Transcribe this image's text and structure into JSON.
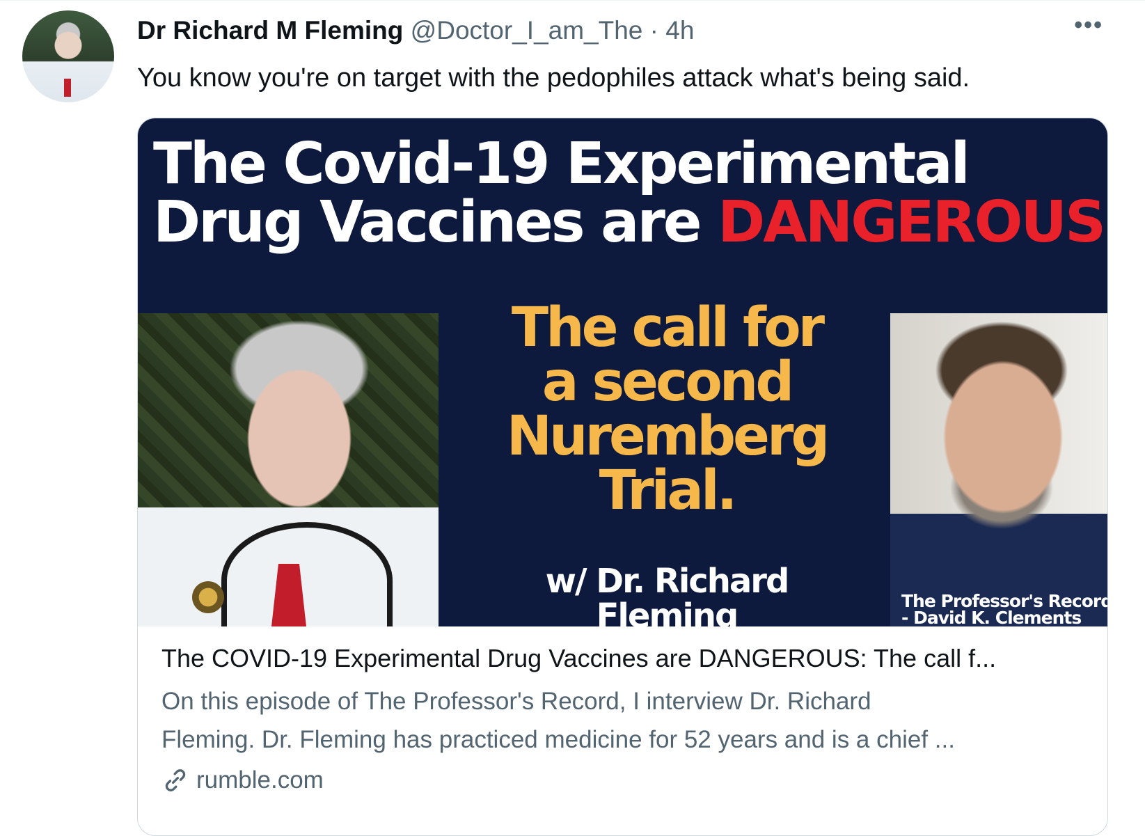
{
  "tweet": {
    "author_name": "Dr Richard M Fleming",
    "handle": "@Doctor_I_am_The",
    "separator": "·",
    "time": "4h",
    "more_label": "•••",
    "text": "You know you're on target with the pedophiles attack what's being said."
  },
  "card": {
    "image": {
      "headline_line1": "The Covid-19 Experimental",
      "headline_line2_start": "Drug Vaccines are",
      "headline_line2_highlight": "DANGEROUS.",
      "call_lines": [
        "The call for",
        "a second",
        "Nuremberg",
        "Trial."
      ],
      "with_line1": "w/ Dr. Richard",
      "with_line2": "Fleming",
      "credit_line1": "The Professor's Record",
      "credit_line2": "- David K. Clements"
    },
    "title": "The COVID-19 Experimental Drug Vaccines are DANGEROUS: The call f...",
    "description_line1": "On this episode of The Professor's Record, I interview Dr. Richard",
    "description_line2": "Fleming. Dr. Fleming has practiced medicine for 52 years and is a chief ...",
    "domain": "rumble.com",
    "link_icon": "link-icon"
  },
  "colors": {
    "media_bg": "#0e1a3d",
    "danger": "#e8212a",
    "accent_yellow": "#f6b84a",
    "secondary_text": "#536471"
  }
}
